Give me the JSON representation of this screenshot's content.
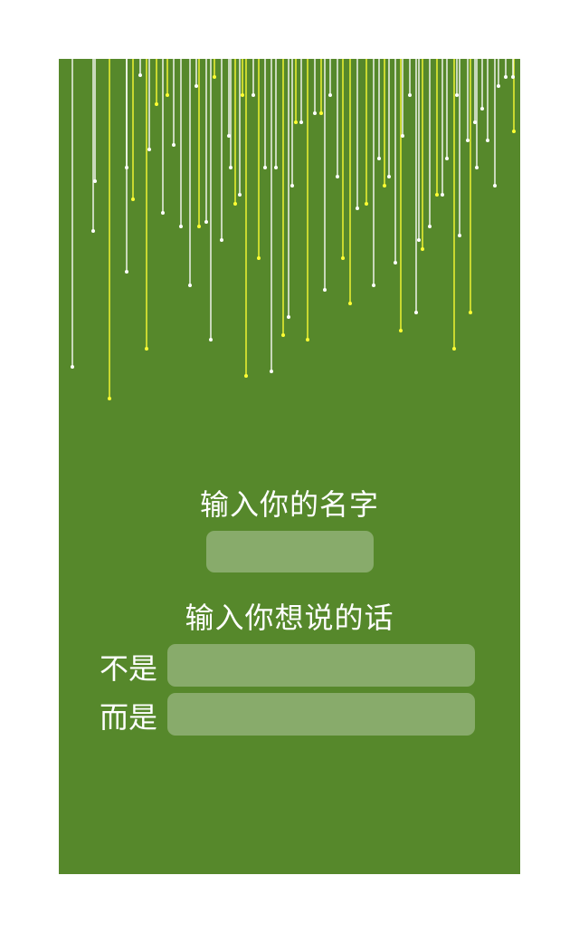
{
  "colors": {
    "page_background": "#ffffff",
    "stage_background": "#56882b",
    "input_background": "#88ab6b",
    "text": "#ffffff",
    "streak_white": "#ffffff",
    "streak_yellow": "#ffff33"
  },
  "form": {
    "name_heading": "输入你的名字",
    "name_value": "",
    "message_heading": "输入你想说的话",
    "not_label": "不是",
    "not_value": "",
    "but_label": "而是",
    "but_value": ""
  },
  "decoration": {
    "name": "falling-light-streaks"
  }
}
